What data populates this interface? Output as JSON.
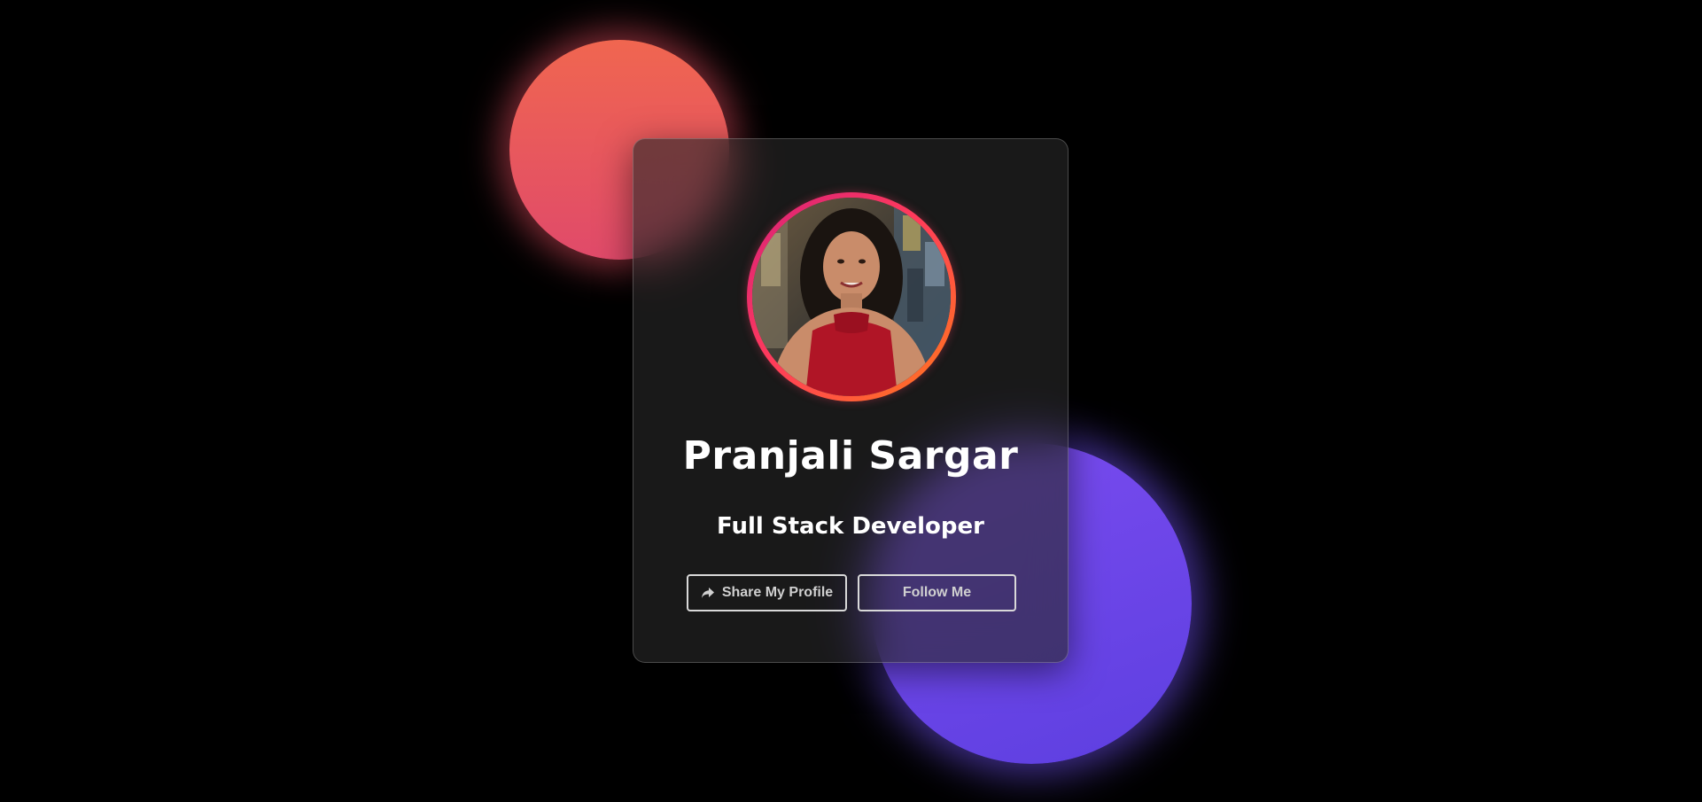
{
  "profile": {
    "name": "Pranjali Sargar",
    "role": "Full Stack Developer",
    "avatar_alt": "profile-photo"
  },
  "actions": {
    "share_label": "Share My Profile",
    "share_icon": "share-arrow-icon",
    "follow_label": "Follow Me"
  },
  "colors": {
    "background": "#000000",
    "blob_coral": "#e8555e",
    "blob_violet": "#6a45ea",
    "ring_start": "#d6207a",
    "ring_end": "#ff7a1a",
    "button_border": "#d9d9d9"
  }
}
